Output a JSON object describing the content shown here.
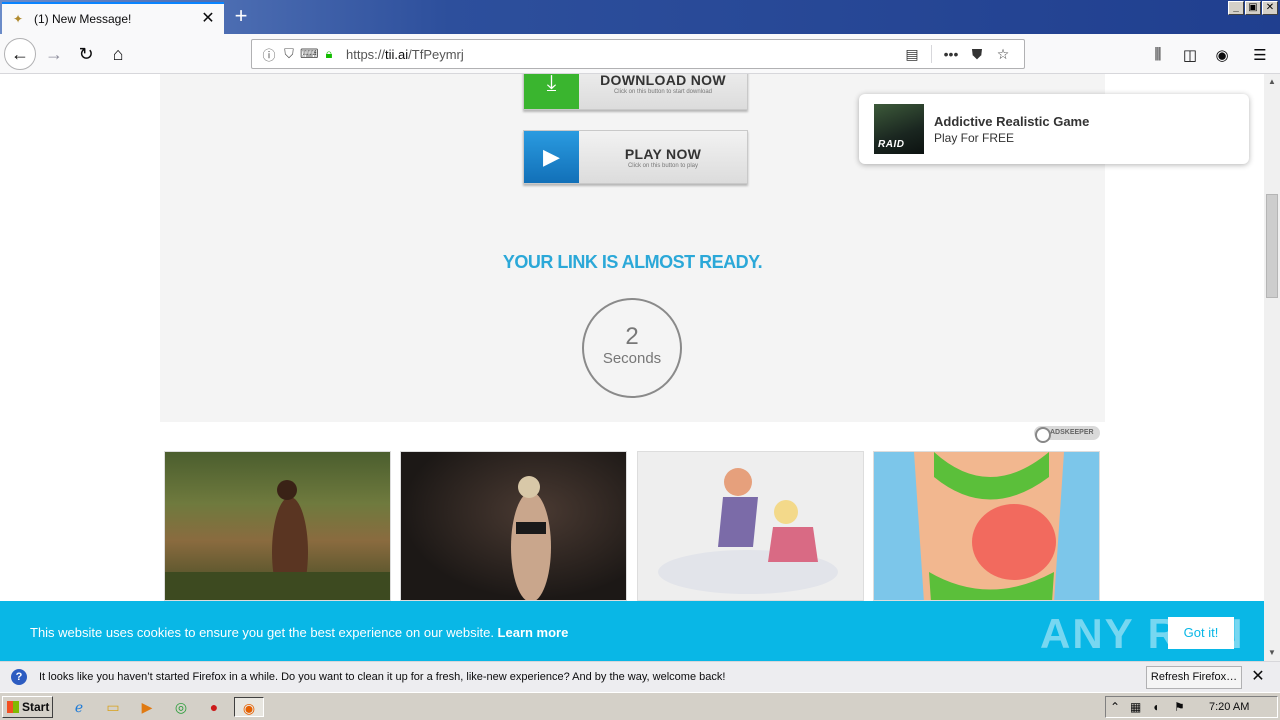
{
  "window": {
    "tab_title": "(1) New Message!",
    "tab_close": "✕",
    "new_tab": "+",
    "controls": [
      "_",
      "▣",
      "✕"
    ]
  },
  "nav": {
    "back": "←",
    "forward": "→",
    "reload": "↻",
    "home": "⌂",
    "url_scheme": "https://",
    "url_host": "tii.ai",
    "url_path": "/TfPeymrj",
    "more": "•••"
  },
  "page": {
    "download_button": {
      "title": "DOWNLOAD NOW",
      "subtitle": "Click on this button to start download"
    },
    "play_button": {
      "title": "PLAY NOW",
      "subtitle": "Click on this button to play"
    },
    "ready_text": "YOUR LINK IS ALMOST READY.",
    "countdown": {
      "number": "2",
      "label": "Seconds"
    },
    "ad_badge": "ADSKEEPER"
  },
  "notification": {
    "title": "Addictive Realistic Game",
    "subtitle": "Play For FREE",
    "image_text": "RAID"
  },
  "cookie": {
    "message": "This website uses cookies to ensure you get the best experience on our website. ",
    "learn_more": "Learn more",
    "button": "Got it!",
    "watermark": "ANY RUN"
  },
  "infobar": {
    "icon": "?",
    "message": "It looks like you haven’t started Firefox in a while. Do you want to clean it up for a fresh, like-new experience? And by the way, welcome back!",
    "button": "Refresh Firefox…",
    "close": "✕"
  },
  "taskbar": {
    "start": "Start",
    "clock": "7:20 AM"
  },
  "colors": {
    "accent_blue": "#2ba8d8",
    "cookie_bg": "#09b7e6",
    "download_green": "#3ab52f",
    "play_blue": "#1270b8"
  }
}
